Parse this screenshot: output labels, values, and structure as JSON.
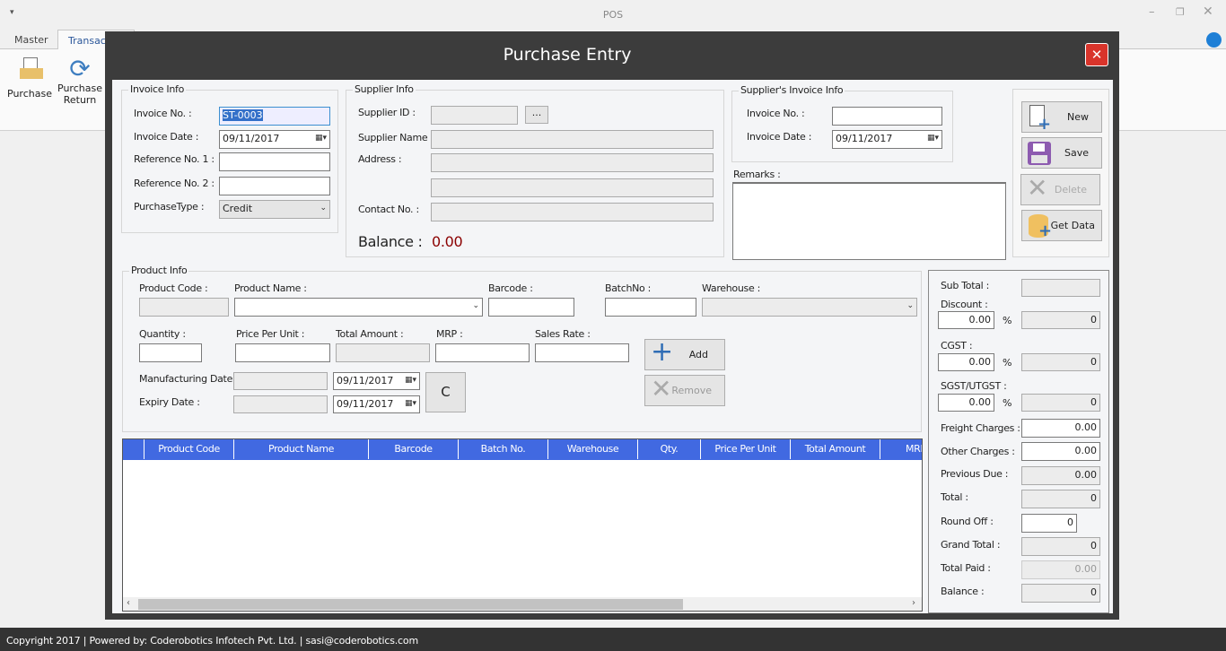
{
  "app": {
    "title": "POS",
    "tabs": [
      {
        "label": "Master"
      },
      {
        "label": "Transaction"
      }
    ],
    "ribbon": [
      {
        "label": "Purchase",
        "icon": "folder-document-icon"
      },
      {
        "label": "Purchase",
        "label2": "Return",
        "icon": "refresh-icon"
      }
    ]
  },
  "dialog": {
    "title": "Purchase Entry",
    "invoice": {
      "title": "Invoice Info",
      "invoice_no_label": "Invoice No. :",
      "invoice_no": "ST-0003",
      "invoice_date_label": "Invoice Date :",
      "invoice_date": "09/11/2017",
      "ref1_label": "Reference No. 1 :",
      "ref1": "",
      "ref2_label": "Reference No. 2 :",
      "ref2": "",
      "type_label": "PurchaseType :",
      "type": "Credit"
    },
    "supplier": {
      "title": "Supplier Info",
      "id_label": "Supplier ID :",
      "browse": "...",
      "name_label": "Supplier Name :",
      "address_label": "Address :",
      "contact_label": "Contact No. :",
      "balance_label": "Balance :",
      "balance": "0.00"
    },
    "sup_invoice": {
      "title": "Supplier's Invoice Info",
      "no_label": "Invoice No. :",
      "no": "",
      "date_label": "Invoice Date :",
      "date": "09/11/2017"
    },
    "remarks_label": "Remarks :",
    "actions": {
      "new": "New",
      "save": "Save",
      "delete": "Delete",
      "get_data": "Get Data"
    },
    "product": {
      "title": "Product Info",
      "code_label": "Product Code :",
      "name_label": "Product Name :",
      "barcode_label": "Barcode :",
      "batch_label": "BatchNo :",
      "warehouse_label": "Warehouse :",
      "qty_label": "Quantity :",
      "ppu_label": "Price Per Unit :",
      "total_label": "Total Amount :",
      "mrp_label": "MRP :",
      "sales_label": "Sales Rate :",
      "mfg_label": "Manufacturing Date :",
      "mfg_date": "09/11/2017",
      "exp_label": "Expiry Date :",
      "exp_date": "09/11/2017",
      "add": "Add",
      "remove": "Remove",
      "clear": "C"
    },
    "grid": {
      "columns": [
        "Product Code",
        "Product Name",
        "Barcode",
        "Batch No.",
        "Warehouse",
        "Qty.",
        "Price Per Unit",
        "Total Amount",
        "MRP"
      ],
      "header_color": "#4169e1"
    },
    "totals": {
      "sub_total_label": "Sub Total :",
      "sub_total": "",
      "discount_label": "Discount :",
      "discount_pct": "0.00",
      "discount": "0",
      "cgst_label": "CGST :",
      "cgst_pct": "0.00",
      "cgst": "0",
      "sgst_label": "SGST/UTGST :",
      "sgst_pct": "0.00",
      "sgst": "0",
      "pct": "%",
      "freight_label": "Freight Charges :",
      "freight": "0.00",
      "other_label": "Other Charges :",
      "other": "0.00",
      "prev_due_label": "Previous Due :",
      "prev_due": "0.00",
      "total_label": "Total :",
      "total": "0",
      "round_label": "Round Off :",
      "round": "0",
      "grand_label": "Grand Total :",
      "grand": "0",
      "paid_label": "Total Paid :",
      "paid": "0.00",
      "balance_label": "Balance :",
      "balance": "0"
    }
  },
  "footer": "Copyright 2017 | Powered by: Coderobotics Infotech Pvt. Ltd. | sasi@coderobotics.com"
}
